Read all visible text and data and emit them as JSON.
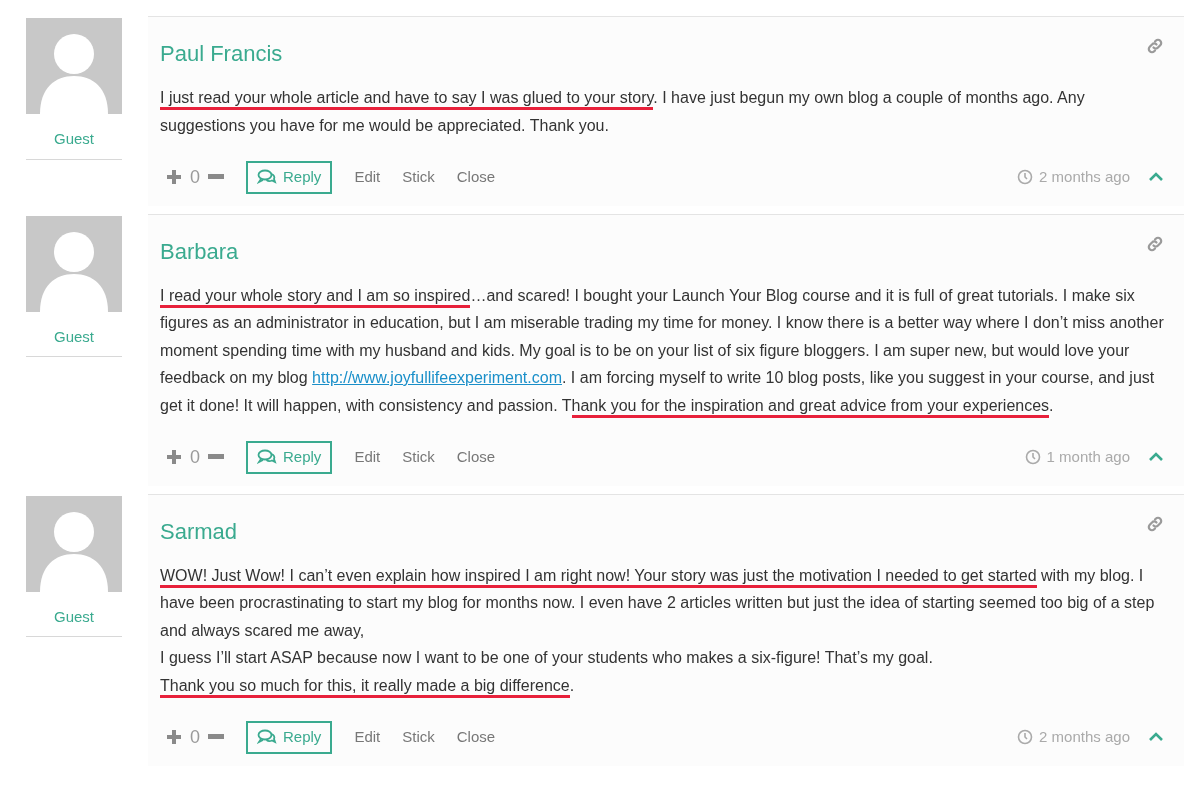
{
  "comments": [
    {
      "author": "Paul Francis",
      "role": "Guest",
      "votes": "0",
      "reply": "Reply",
      "actions": [
        "Edit",
        "Stick",
        "Close"
      ],
      "time": "2 months ago",
      "paragraphs": [
        [
          {
            "kind": "text",
            "text": "I just read your whole article and have to say I was glued to your story",
            "underlined": true
          },
          {
            "kind": "text",
            "text": ". I have just begun my own blog a couple of months ago. Any suggestions you have for me would be appreciated. Thank you.",
            "underlined": false
          }
        ]
      ]
    },
    {
      "author": "Barbara",
      "role": "Guest",
      "votes": "0",
      "reply": "Reply",
      "actions": [
        "Edit",
        "Stick",
        "Close"
      ],
      "time": "1 month ago",
      "paragraphs": [
        [
          {
            "kind": "text",
            "text": "I read your whole story and I am so inspired",
            "underlined": true
          },
          {
            "kind": "text",
            "text": "…and scared! I bought your Launch Your Blog course and it is full of great tutorials. I make six figures as an administrator in education, but I am miserable trading my time for money. I know there is a better way where I don’t miss another moment spending time with my husband and kids. My goal is to be on your list of six figure bloggers. I am super new, but would love your feedback on my blog ",
            "underlined": false
          },
          {
            "kind": "link",
            "text": "http://www.joyfullifeexperiment.com",
            "underlined": false
          },
          {
            "kind": "text",
            "text": ". I am forcing myself to write 10 blog posts, like you suggest in your course, and just get it done! It will happen, with consistency and passion. T",
            "underlined": false
          },
          {
            "kind": "text",
            "text": "hank you for the inspiration and great advice from your experiences",
            "underlined": true
          },
          {
            "kind": "text",
            "text": ".",
            "underlined": false
          }
        ]
      ]
    },
    {
      "author": "Sarmad",
      "role": "Guest",
      "votes": "0",
      "reply": "Reply",
      "actions": [
        "Edit",
        "Stick",
        "Close"
      ],
      "time": "2 months ago",
      "paragraphs": [
        [
          {
            "kind": "text",
            "text": "WOW! Just Wow! I can’t even explain how inspired I am right now! Your story was just the motivation I needed to get started",
            "underlined": true
          },
          {
            "kind": "text",
            "text": " with my blog. I have been procrastinating to start my blog for months now. I even have 2 articles written but just the idea of starting seemed too big of a step and always scared me away,",
            "underlined": false
          }
        ],
        [
          {
            "kind": "text",
            "text": "I guess I’ll start ASAP because now I want to be one of your students who makes a six-figure! That’s my goal.",
            "underlined": false
          }
        ],
        [
          {
            "kind": "text",
            "text": "Thank you so much for this, it really made a big difference",
            "underlined": true
          },
          {
            "kind": "text",
            "text": ".",
            "underlined": false
          }
        ]
      ]
    }
  ]
}
